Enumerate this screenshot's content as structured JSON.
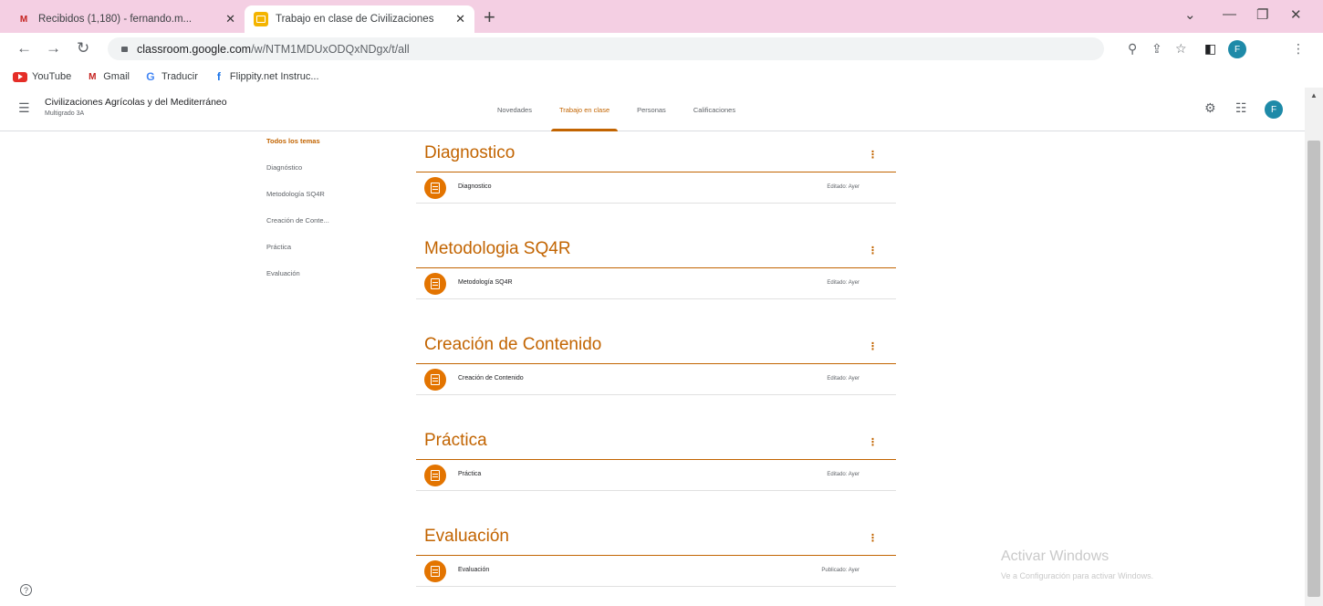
{
  "browser": {
    "tabs": [
      {
        "title": "Recibidos (1,180) - fernando.m...",
        "favicon": "gmail-icon"
      },
      {
        "title": "Trabajo en clase de Civilizaciones",
        "favicon": "classroom-icon"
      }
    ],
    "url_host": "classroom.google.com",
    "url_path": "/w/NTM1MDUxODQxNDgx/t/all",
    "profile_initial": "F",
    "bookmarks": [
      {
        "label": "YouTube",
        "icon": "youtube-icon"
      },
      {
        "label": "Gmail",
        "icon": "gmail-icon"
      },
      {
        "label": "Traducir",
        "icon": "google-translate-icon"
      },
      {
        "label": "Flippity.net Instruc...",
        "icon": "flippity-icon"
      }
    ]
  },
  "classroom": {
    "class_name": "Civilizaciones Agrícolas y del Mediterráneo",
    "section": "Multigrado 3A",
    "nav_tabs": [
      "Novedades",
      "Trabajo en clase",
      "Personas",
      "Calificaciones"
    ],
    "active_tab": "Trabajo en clase",
    "avatar_initial": "F"
  },
  "topic_nav": {
    "items": [
      "Todos los temas",
      "Diagnóstico",
      "Metodología SQ4R",
      "Creación de Conte...",
      "Práctica",
      "Evaluación"
    ]
  },
  "topics": [
    {
      "title": "Diagnostico",
      "items": [
        {
          "title": "Diagnostico",
          "status": "Editado: Ayer"
        }
      ]
    },
    {
      "title": "Metodologia SQ4R",
      "items": [
        {
          "title": "Metodología SQ4R",
          "status": "Editado: Ayer"
        }
      ]
    },
    {
      "title": "Creación de Contenido",
      "items": [
        {
          "title": "Creación de Contenido",
          "status": "Editado: Ayer"
        }
      ]
    },
    {
      "title": "Práctica",
      "items": [
        {
          "title": "Práctica",
          "status": "Editado: Ayer"
        }
      ]
    },
    {
      "title": "Evaluación",
      "items": [
        {
          "title": "Evaluación",
          "status": "Publicado: Ayer"
        }
      ]
    }
  ],
  "watermark": {
    "line1": "Activar Windows",
    "line2": "Ve a Configuración para activar Windows."
  },
  "colors": {
    "accent": "#c26401",
    "icon_bg": "#e37400",
    "tabstrip": "#f4cfe3"
  }
}
